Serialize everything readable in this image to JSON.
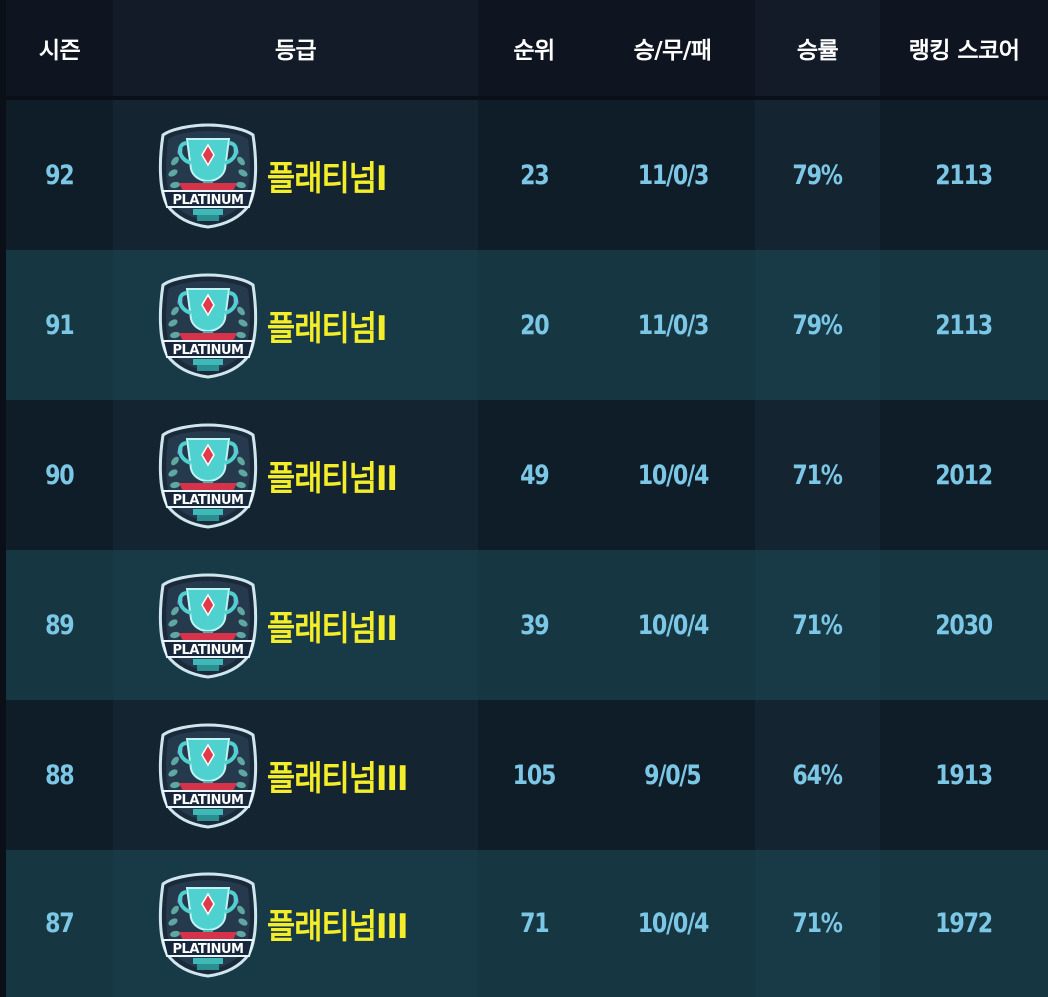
{
  "headers": {
    "season": "시즌",
    "grade": "등급",
    "rank": "순위",
    "record": "승/무/패",
    "win_rate": "승률",
    "ranking_score": "랭킹 스코어"
  },
  "emblem": {
    "icon": "platinum-trophy-emblem",
    "label": "PLATINUM"
  },
  "rows": [
    {
      "season": "92",
      "grade": "플래티넘I",
      "rank": "23",
      "record": "11/0/3",
      "win_rate": "79%",
      "score": "2113"
    },
    {
      "season": "91",
      "grade": "플래티넘I",
      "rank": "20",
      "record": "11/0/3",
      "win_rate": "79%",
      "score": "2113"
    },
    {
      "season": "90",
      "grade": "플래티넘II",
      "rank": "49",
      "record": "10/0/4",
      "win_rate": "71%",
      "score": "2012"
    },
    {
      "season": "89",
      "grade": "플래티넘II",
      "rank": "39",
      "record": "10/0/4",
      "win_rate": "71%",
      "score": "2030"
    },
    {
      "season": "88",
      "grade": "플래티넘III",
      "rank": "105",
      "record": "9/0/5",
      "win_rate": "64%",
      "score": "1913"
    },
    {
      "season": "87",
      "grade": "플래티넘III",
      "rank": "71",
      "record": "10/0/4",
      "win_rate": "71%",
      "score": "1972"
    }
  ],
  "colors": {
    "value_text": "#7cc7e6",
    "grade_text": "#f4ee2a",
    "header_text": "#ffffff"
  }
}
